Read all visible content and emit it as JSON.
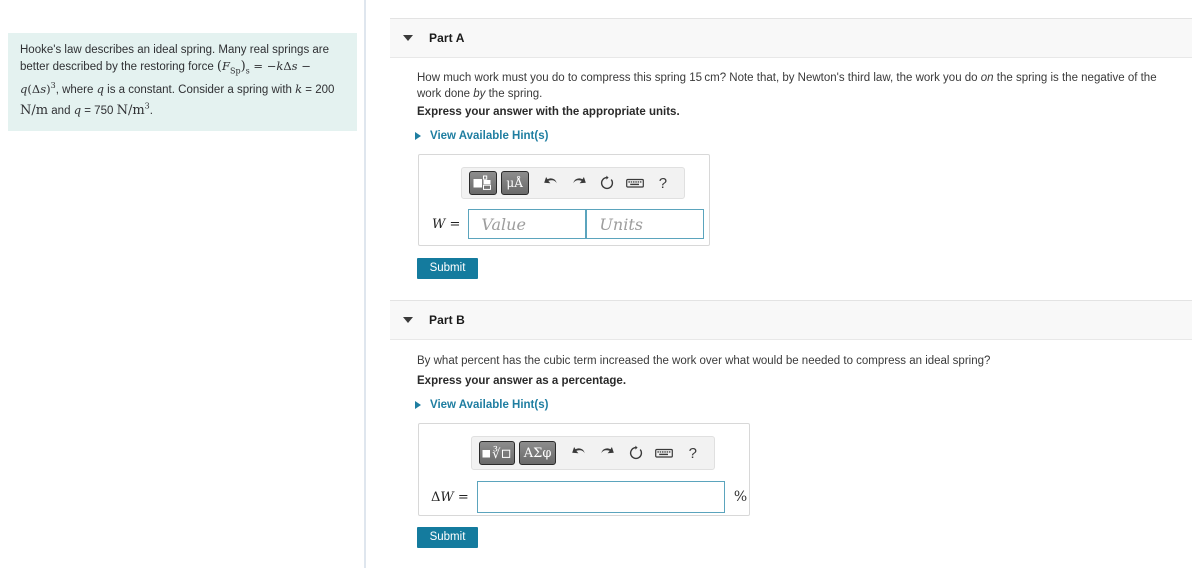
{
  "problem": {
    "text_line1": "Hooke's law describes an ideal spring. Many real springs are better",
    "text_line2_pre": "described by the restoring force ",
    "formula": "(F_Sp)_s = −kΔs − q(Δs)³",
    "text_line2_post": ", where",
    "text_line3": "q is a constant. Consider a spring with k = 200 N/m and",
    "text_line4": "q = 750 N/m³.",
    "constant_k_label": "k",
    "constant_k_value": "200",
    "constant_k_units": "N/m",
    "constant_q_label": "q",
    "constant_q_value": "750",
    "constant_q_units": "N/m",
    "bg_color": "#e4f2f0"
  },
  "parts": [
    {
      "id": "a",
      "title": "Part A",
      "question": "How much work must you do to compress this spring 15 cm? Note that, by Newton's third law, the work you do on the spring is the negative of the work done by the spring.",
      "question_seg1": "How much work must you do to compress this spring 15 cm? Note that, by Newton's third law, the work you do ",
      "question_em1": "on",
      "question_seg2": " the spring is the negative of the work done ",
      "question_em2": "by",
      "question_seg3": " the spring.",
      "instruction": "Express your answer with the appropriate units.",
      "hint_label": "View Available Hint(s)",
      "toolbar": {
        "template_button": "template-icon",
        "units_button": "μÅ",
        "undo_icon": "undo-icon",
        "redo_icon": "redo-icon",
        "reset_icon": "reset-icon",
        "keyboard_icon": "keyboard-icon",
        "help_icon": "?"
      },
      "answer": {
        "label": "W",
        "equals": "=",
        "value": "",
        "value_placeholder": "Value",
        "units": "",
        "units_placeholder": "Units"
      },
      "submit_label": "Submit"
    },
    {
      "id": "b",
      "title": "Part B",
      "question": "By what percent has the cubic term increased the work over what would be needed to compress an ideal spring?",
      "instruction": "Express your answer as a percentage.",
      "hint_label": "View Available Hint(s)",
      "toolbar": {
        "template_button": "radical-template-icon",
        "greek_button": "ΑΣφ",
        "undo_icon": "undo-icon",
        "redo_icon": "redo-icon",
        "reset_icon": "reset-icon",
        "keyboard_icon": "keyboard-icon",
        "help_icon": "?"
      },
      "answer": {
        "label": "ΔW",
        "equals": "=",
        "value": "",
        "value_placeholder": "",
        "suffix": "%"
      },
      "submit_label": "Submit"
    }
  ],
  "colors": {
    "accent": "#147b9e",
    "link": "#1f7ea1",
    "input_border": "#5ba4bd",
    "header_bg": "#f8f8f8",
    "problem_bg": "#e4f2f0"
  }
}
